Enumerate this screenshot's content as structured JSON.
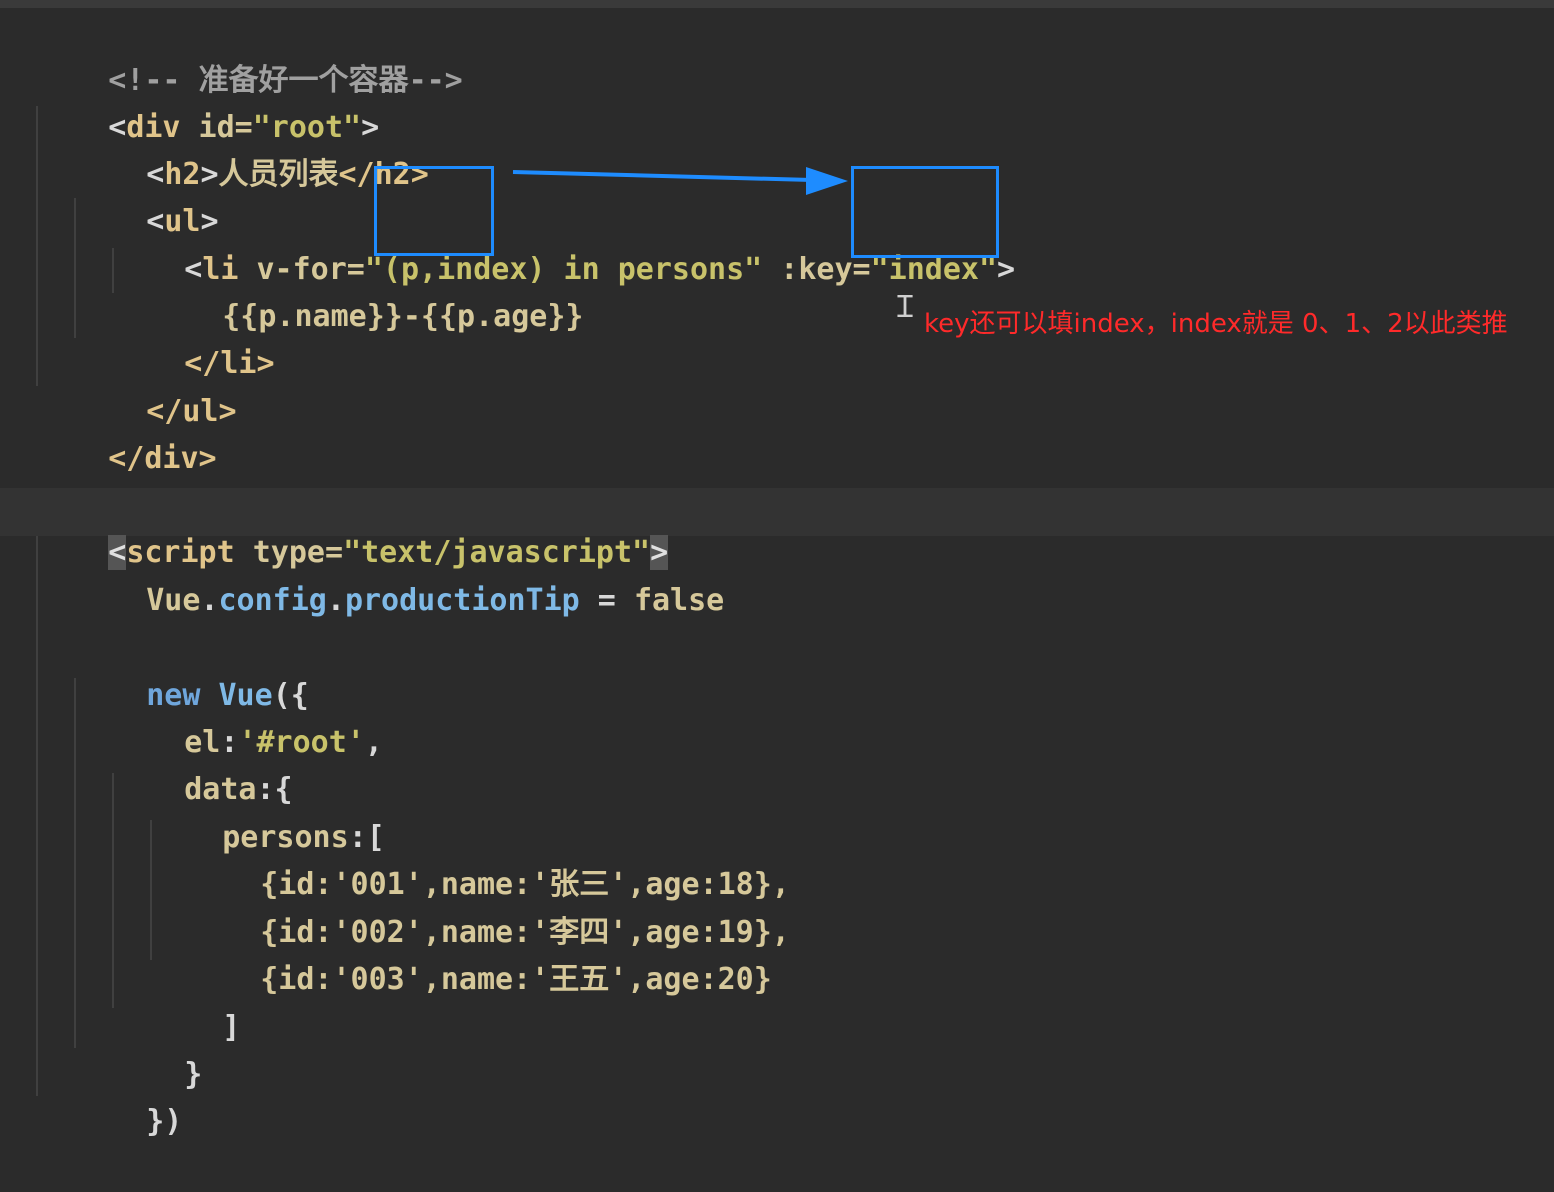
{
  "code": {
    "l1": {
      "open": "<!-- ",
      "text": "准备好一个容器",
      "close": "-->"
    },
    "l2": {
      "lt": "<",
      "tag": "div",
      "attr": " id=",
      "val": "\"root\"",
      "gt": ">"
    },
    "l3": {
      "lt": "<",
      "tag": "h2",
      "gt": ">",
      "text": "人员列表",
      "close": "</h2>"
    },
    "l4": {
      "lt": "<",
      "tag": "ul",
      "gt": ">"
    },
    "l5": {
      "lt": "<",
      "tag": "li",
      "attr1": " v-for=",
      "val1": "\"(p,index) in persons\"",
      "attr2": " :key=",
      "val2": "\"index\"",
      "gt": ">"
    },
    "l6": {
      "text": "{{p.name}}-{{p.age}}"
    },
    "l7": {
      "text": "</li>"
    },
    "l8": {
      "text": "</ul>"
    },
    "l9": {
      "text": "</div>"
    },
    "l11": {
      "lt": "<",
      "tag": "script",
      "attr": " type=",
      "val": "\"text/javascript\"",
      "gt": ">"
    },
    "l12": {
      "obj": "Vue",
      "dot1": ".",
      "prop1": "config",
      "dot2": ".",
      "prop2": "productionTip",
      "eq": " = ",
      "val": "false"
    },
    "l14": {
      "kw": "new ",
      "cls": "Vue",
      "rest": "({"
    },
    "l15": {
      "key": "el",
      "rest": ":",
      "val": "'#root'",
      "end": ","
    },
    "l16": {
      "key": "data",
      "rest": ":{"
    },
    "l17": {
      "key": "persons",
      "rest": ":["
    },
    "rows": [
      {
        "text": "{id:'001',name:'张三',age:18},"
      },
      {
        "text": "{id:'002',name:'李四',age:19},"
      },
      {
        "text": "{id:'003',name:'王五',age:20}"
      }
    ],
    "l21": {
      "text": "]"
    },
    "l22": {
      "text": "}"
    },
    "l23": {
      "text": "})"
    }
  },
  "annotation": {
    "text": "key还可以填index，index就是 0、1、2以此类推"
  },
  "colors": {
    "box": "#1e8cff",
    "annotation": "#ff2a2a",
    "background": "#2b2b2b"
  },
  "icons": {
    "cursor": "text-cursor-icon",
    "arrow": "arrow-right-icon"
  }
}
